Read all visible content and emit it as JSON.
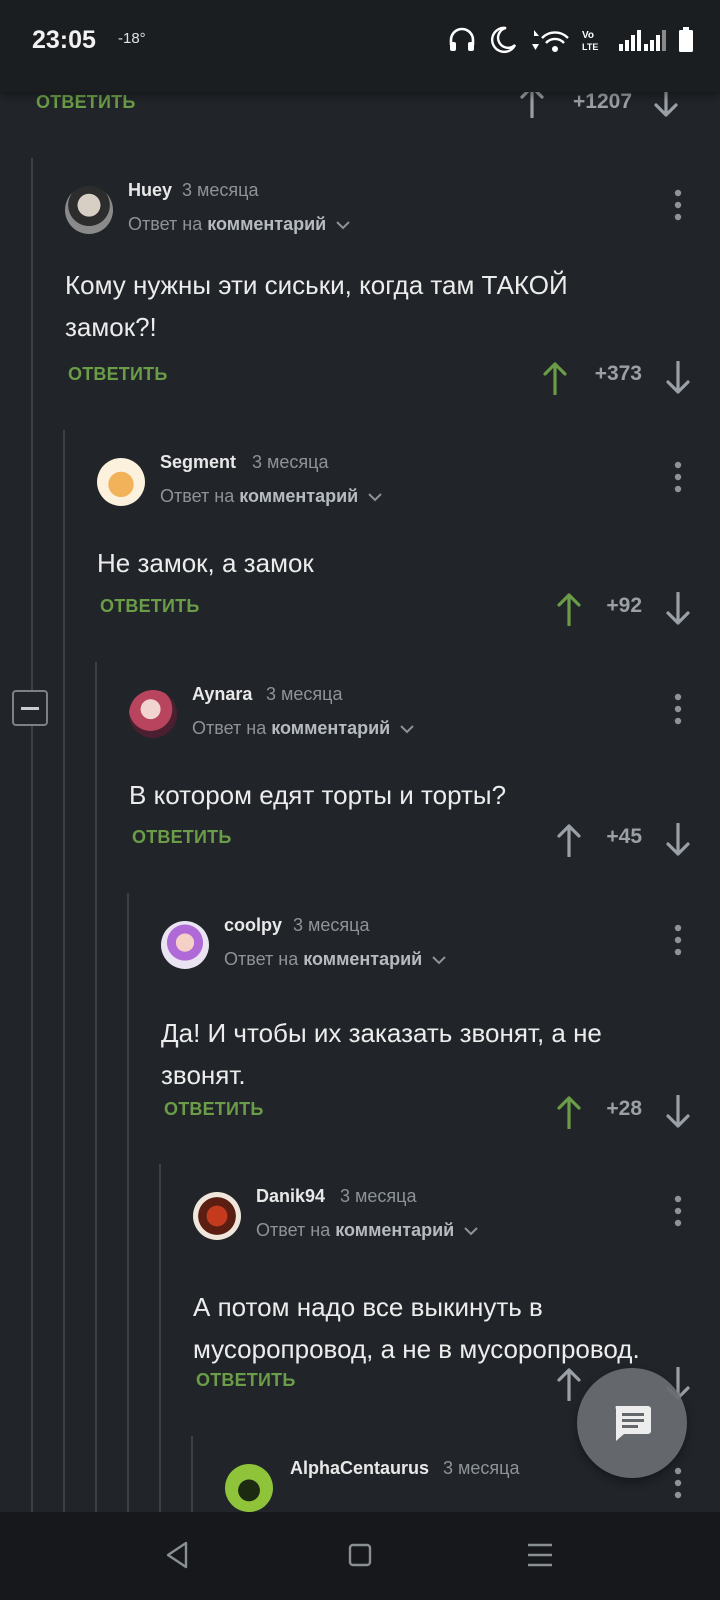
{
  "status": {
    "time": "23:05",
    "temp": "-18°"
  },
  "top_partial": {
    "reply_label": "ОТВЕТИТЬ",
    "score": "+1207"
  },
  "comments": [
    {
      "author": "Huey",
      "time": "3 месяца",
      "reply_prefix": "Ответ на",
      "reply_target": "комментарий",
      "text": "Кому нужны эти сиськи, когда там ТАКОЙ замок?!",
      "reply_label": "ОТВЕТИТЬ",
      "score": "+373"
    },
    {
      "author": "Segment",
      "time": "3 месяца",
      "reply_prefix": "Ответ на",
      "reply_target": "комментарий",
      "text": "Не замок, а замок",
      "reply_label": "ОТВЕТИТЬ",
      "score": "+92"
    },
    {
      "author": "Aynara",
      "time": "3 месяца",
      "reply_prefix": "Ответ на",
      "reply_target": "комментарий",
      "text": "В котором едят торты и торты?",
      "reply_label": "ОТВЕТИТЬ",
      "score": "+45"
    },
    {
      "author": "coolpy",
      "time": "3 месяца",
      "reply_prefix": "Ответ на",
      "reply_target": "комментарий",
      "text": "Да! И чтобы их заказать звонят, а не звонят.",
      "reply_label": "ОТВЕТИТЬ",
      "score": "+28"
    },
    {
      "author": "Danik94",
      "time": "3 месяца",
      "reply_prefix": "Ответ на",
      "reply_target": "комментарий",
      "text": "А потом надо все выкинуть в мусоропровод, а не в мусоропровод.",
      "reply_label": "ОТВЕТИТЬ",
      "score": ""
    },
    {
      "author": "AlphaCentaurus",
      "time": "3 месяца"
    }
  ],
  "colors": {
    "background": "#212529",
    "reply_link": "#6b9c47",
    "upvoted_arrow": "#6b9c47",
    "neutral_arrow": "#9aa0a6"
  },
  "icons": [
    "headphones-icon",
    "moon-icon",
    "wifi-icon",
    "volte-icon",
    "signal-icon",
    "battery-icon",
    "more-vert-icon",
    "chevron-down-icon",
    "arrow-up-icon",
    "arrow-down-icon",
    "collapse-icon",
    "chat-icon",
    "nav-back-icon",
    "nav-home-icon",
    "nav-menu-icon"
  ]
}
